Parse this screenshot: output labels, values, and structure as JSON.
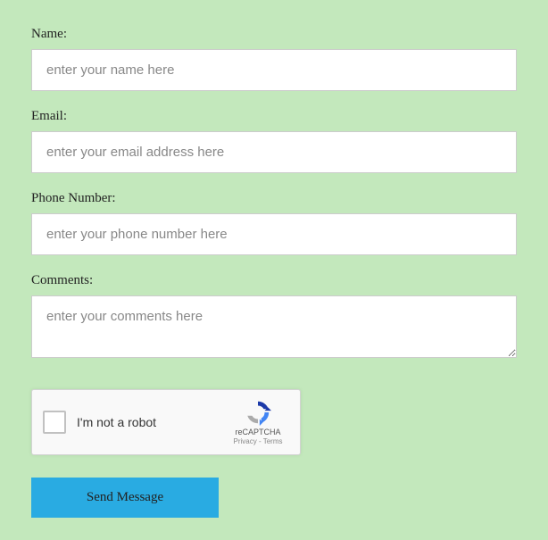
{
  "form": {
    "name": {
      "label": "Name:",
      "placeholder": "enter your name here"
    },
    "email": {
      "label": "Email:",
      "placeholder": "enter your email address here"
    },
    "phone": {
      "label": "Phone Number:",
      "placeholder": "enter your phone number here"
    },
    "comments": {
      "label": "Comments:",
      "placeholder": "enter your comments here"
    }
  },
  "recaptcha": {
    "label": "I'm not a robot",
    "brand": "reCAPTCHA",
    "links": "Privacy - Terms"
  },
  "submit": {
    "label": "Send Message"
  }
}
